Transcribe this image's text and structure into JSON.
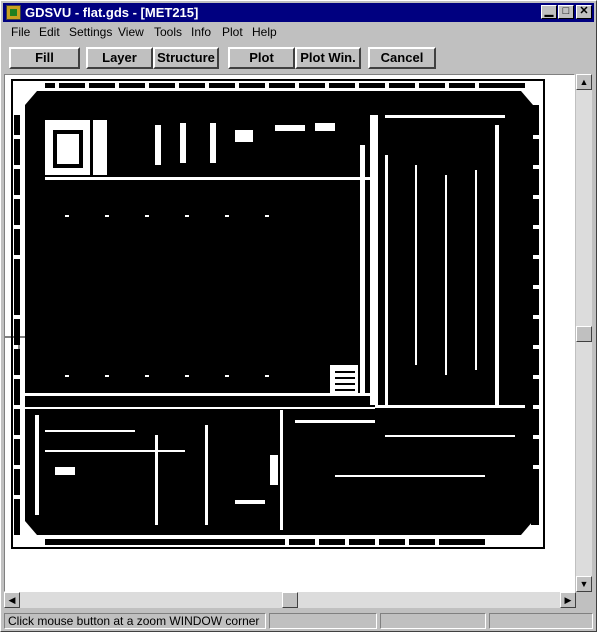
{
  "window": {
    "title": "GDSVU - flat.gds - [MET215]"
  },
  "titlebar": {
    "minimize_glyph": "▁",
    "maximize_glyph": "□",
    "close_glyph": "✕"
  },
  "menu": {
    "items": [
      {
        "label": "File"
      },
      {
        "label": "Edit"
      },
      {
        "label": "Settings"
      },
      {
        "label": "View"
      },
      {
        "label": "Tools"
      },
      {
        "label": "Info"
      },
      {
        "label": "Plot"
      },
      {
        "label": "Help"
      }
    ]
  },
  "toolbar": {
    "buttons": [
      {
        "label": "Fill"
      },
      {
        "label": "Layer"
      },
      {
        "label": "Structure"
      },
      {
        "label": "Plot"
      },
      {
        "label": "Plot Win."
      },
      {
        "label": "Cancel"
      }
    ]
  },
  "canvas": {
    "layout_fill_color": "#000000",
    "background_color": "#ffffff"
  },
  "scrollbars": {
    "up_glyph": "▲",
    "down_glyph": "▼",
    "left_glyph": "◀",
    "right_glyph": "▶"
  },
  "status": {
    "message": "Click mouse button at a zoom WINDOW corner"
  }
}
